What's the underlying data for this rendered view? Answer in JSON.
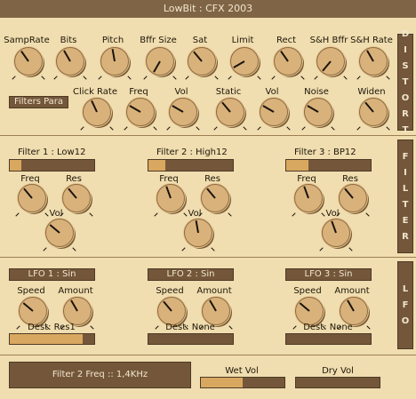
{
  "window": {
    "title": "LowBit : CFX 2003"
  },
  "distort": {
    "tab_letters": [
      "D",
      "I",
      "S",
      "T",
      "O",
      "R",
      "T"
    ],
    "row1": [
      {
        "label": "SampRate",
        "angle": -35
      },
      {
        "label": "Bits",
        "angle": -30
      },
      {
        "label": "Pitch",
        "angle": -10
      },
      {
        "label": "Bffr Size",
        "angle": -150
      },
      {
        "label": "Sat",
        "angle": -40
      },
      {
        "label": "Limit",
        "angle": -120
      },
      {
        "label": "Rect",
        "angle": -35
      },
      {
        "label": "S&H Bffr",
        "angle": -140
      },
      {
        "label": "S&H Rate",
        "angle": -30
      }
    ],
    "filters_button": "Filters Para",
    "row2": [
      {
        "label": "Click Rate",
        "angle": -25
      },
      {
        "label": "Freq",
        "angle": -60
      },
      {
        "label": "Vol",
        "angle": -60
      },
      {
        "label": "Static",
        "angle": -40
      },
      {
        "label": "Vol",
        "angle": -60
      },
      {
        "label": "Noise",
        "angle": -60
      },
      {
        "label": "Widen",
        "angle": -40
      }
    ]
  },
  "filter": {
    "tab_letters": [
      "F",
      "I",
      "L",
      "T",
      "E",
      "R"
    ],
    "filters": [
      {
        "title": "Filter 1 : Low12",
        "amount": 0.14,
        "freq_label": "Freq",
        "res_label": "Res",
        "vol_label": "Vol",
        "freq_angle": -40,
        "res_angle": -40,
        "vol_angle": -50
      },
      {
        "title": "Filter 2 : High12",
        "amount": 0.2,
        "freq_label": "Freq",
        "res_label": "Res",
        "vol_label": "Vol",
        "freq_angle": -20,
        "res_angle": -40,
        "vol_angle": -10
      },
      {
        "title": "Filter 3 : BP12",
        "amount": 0.26,
        "freq_label": "Freq",
        "res_label": "Res",
        "vol_label": "Vol",
        "freq_angle": -20,
        "res_angle": -40,
        "vol_angle": -20
      }
    ]
  },
  "lfo": {
    "tab_letters": [
      "L",
      "F",
      "O"
    ],
    "lfos": [
      {
        "title": "LFO 1 : Sin",
        "speed_label": "Speed",
        "amount_label": "Amount",
        "dest": "Dest: Res1",
        "dest_amount": 0.86,
        "speed_angle": -50,
        "amount_angle": -30
      },
      {
        "title": "LFO 2 : Sin",
        "speed_label": "Speed",
        "amount_label": "Amount",
        "dest": "Dest: None",
        "dest_amount": 0,
        "speed_angle": -40,
        "amount_angle": -30
      },
      {
        "title": "LFO 3 : Sin",
        "speed_label": "Speed",
        "amount_label": "Amount",
        "dest": "Dest: None",
        "dest_amount": 0,
        "speed_angle": -50,
        "amount_angle": -30
      }
    ]
  },
  "bottom": {
    "status": "Filter 2 Freq :: 1,4KHz",
    "wet_label": "Wet Vol",
    "wet_amount": 0.5,
    "dry_label": "Dry Vol",
    "dry_amount": 0
  }
}
